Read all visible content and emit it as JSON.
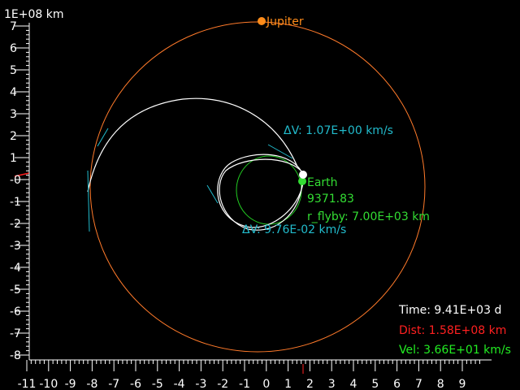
{
  "axis": {
    "unit_label": "1E+08 km",
    "x_ticks": [
      "-11",
      "-10",
      "-9",
      "-8",
      "-7",
      "-6",
      "-5",
      "-4",
      "-3",
      "-2",
      "-1",
      "0",
      "1",
      "2",
      "3",
      "4",
      "5",
      "6",
      "7",
      "8",
      "9"
    ],
    "y_ticks": [
      "7",
      "6",
      "5",
      "4",
      "3",
      "2",
      "1",
      "-0",
      "-1",
      "-2",
      "-3",
      "-4",
      "-5",
      "-6",
      "-7",
      "-8"
    ],
    "x_range": [
      -11,
      9.5
    ],
    "y_range": [
      -8,
      7
    ]
  },
  "bodies": {
    "jupiter": {
      "label": "Jupiter",
      "x": -0.45,
      "y": 7.1,
      "color": "#ff8c1a"
    },
    "earth": {
      "label": "Earth",
      "x": 1.3,
      "y": -0.05,
      "color": "#33dd33"
    },
    "spacecraft": {
      "x": 1.35,
      "y": 0.3,
      "color": "#ffffff"
    }
  },
  "annotations": {
    "dv1": "ΔV: 1.07E+00 km/s",
    "dv2": "ΔV: 9.76E-02 km/s",
    "earth_value": "9371.83",
    "r_flyby": "r_flyby: 7.00E+03 km"
  },
  "status": {
    "time": "Time: 9.41E+03 d",
    "dist": "Dist: 1.58E+08 km",
    "vel": "Vel: 3.66E+01 km/s"
  },
  "colors": {
    "jupiter_orbit": "#ff7a2a",
    "earth_orbit": "#22cc22",
    "trajectory": "#ffffff",
    "delta_v": "#22bbcc",
    "dist_text": "#ff2020",
    "vel_text": "#22ee22",
    "time_text": "#ffffff"
  }
}
